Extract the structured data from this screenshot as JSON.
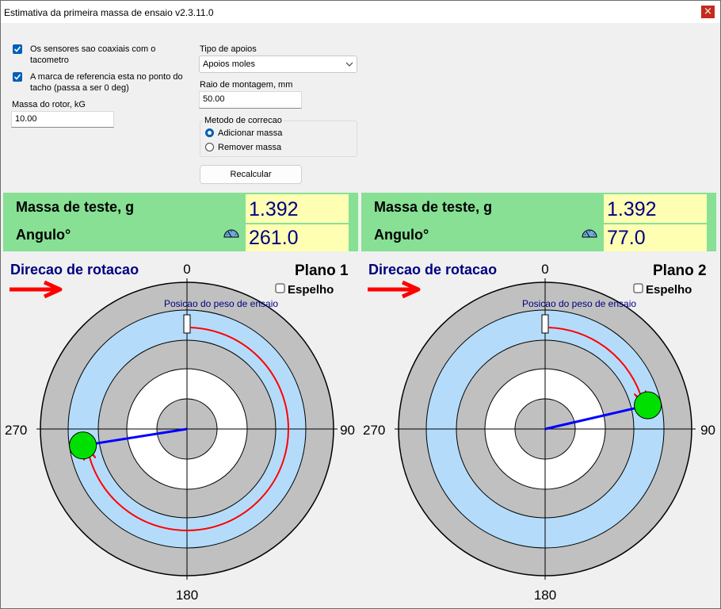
{
  "window": {
    "title": "Estimativa da primeira massa de ensaio v2.3.11.0",
    "close_glyph": "×"
  },
  "settings": {
    "coaxial_checkbox": {
      "label": "Os sensores sao coaxiais com o tacometro",
      "checked": true
    },
    "reference_checkbox": {
      "label": "A marca de referencia esta no ponto do tacho (passa a ser 0 deg)",
      "checked": true
    },
    "rotor_mass": {
      "label": "Massa do rotor, kG",
      "value": "10.00"
    },
    "support_type": {
      "label": "Tipo de apoios",
      "selected": "Apoios moles"
    },
    "mounting_radius": {
      "label": "Raio de montagem, mm",
      "value": "50.00"
    },
    "correction_method": {
      "label": "Metodo de correcao",
      "options": [
        {
          "label": "Adicionar massa",
          "selected": true
        },
        {
          "label": "Remover massa",
          "selected": false
        }
      ]
    },
    "recalc_button": "Recalcular"
  },
  "planes": [
    {
      "mass_label": "Massa de teste, g",
      "angle_label": "Angulo°",
      "mass_value": "1.392",
      "angle_value": "261.0",
      "angle_deg": 261,
      "rotation_label": "Direcao de rotacao",
      "plane_title": "Plano 1",
      "mirror_label": "Espelho",
      "mirror_checked": false,
      "position_label": "Posicao do peso de ensaio",
      "ticks": {
        "top": "0",
        "right": "90",
        "bottom": "180",
        "left": "270"
      }
    },
    {
      "mass_label": "Massa de teste, g",
      "angle_label": "Angulo°",
      "mass_value": "1.392",
      "angle_value": "77.0",
      "angle_deg": 77,
      "rotation_label": "Direcao de rotacao",
      "plane_title": "Plano 2",
      "mirror_label": "Espelho",
      "mirror_checked": false,
      "position_label": "Posicao do peso de ensaio",
      "ticks": {
        "top": "0",
        "right": "90",
        "bottom": "180",
        "left": "270"
      }
    }
  ],
  "colors": {
    "result_panel": "#87e094",
    "value_box": "#ffffb4",
    "ring_gray": "#c0c0c0",
    "ring_blue": "#b4dcfa",
    "vector": "#0000ff",
    "arc": "#ff0000",
    "weight": "#00ff00",
    "heading": "#000080"
  }
}
